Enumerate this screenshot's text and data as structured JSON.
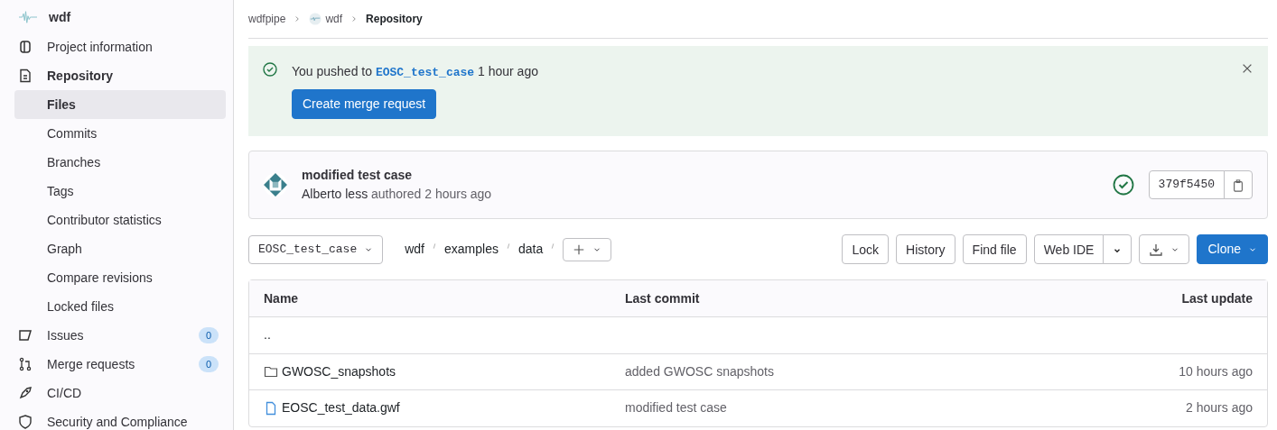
{
  "sidebar": {
    "project": {
      "name": "wdf"
    },
    "items": [
      {
        "label": "Project information",
        "kind": "info",
        "selected": false
      },
      {
        "label": "Repository",
        "kind": "repo",
        "selected": false,
        "children": [
          {
            "label": "Files",
            "selected": true
          },
          {
            "label": "Commits",
            "selected": false
          },
          {
            "label": "Branches",
            "selected": false
          },
          {
            "label": "Tags",
            "selected": false
          },
          {
            "label": "Contributor statistics",
            "selected": false
          },
          {
            "label": "Graph",
            "selected": false
          },
          {
            "label": "Compare revisions",
            "selected": false
          },
          {
            "label": "Locked files",
            "selected": false
          }
        ]
      },
      {
        "label": "Issues",
        "kind": "issues",
        "selected": false,
        "badge": "0"
      },
      {
        "label": "Merge requests",
        "kind": "merge",
        "selected": false,
        "badge": "0"
      },
      {
        "label": "CI/CD",
        "kind": "rocket",
        "selected": false
      },
      {
        "label": "Security and Compliance",
        "kind": "shield",
        "selected": false
      }
    ]
  },
  "breadcrumbs": [
    {
      "label": "wdfpipe",
      "avatar": false
    },
    {
      "label": "wdf",
      "avatar": true
    },
    {
      "label": "Repository",
      "avatar": false
    }
  ],
  "alert": {
    "text_before": "You pushed to",
    "branch": "EOSC_test_case",
    "text_after": "1 hour ago",
    "button": "Create merge request"
  },
  "commit": {
    "title": "modified test case",
    "author": "Alberto less",
    "meta": "authored 2 hours ago",
    "sha": "379f5450"
  },
  "toolbar": {
    "branch": "EOSC_test_case",
    "path": [
      "wdf",
      "examples",
      "data"
    ],
    "buttons": [
      {
        "label": "Lock",
        "kind": "plain"
      },
      {
        "label": "History",
        "kind": "plain"
      },
      {
        "label": "Find file",
        "kind": "plain"
      },
      {
        "label": "Web IDE",
        "kind": "split"
      },
      {
        "kind": "download"
      },
      {
        "label": "Clone",
        "kind": "primary"
      }
    ]
  },
  "table": {
    "columns": [
      "Name",
      "Last commit",
      "Last update"
    ],
    "rows": [
      {
        "kind": "parent",
        "name": ".."
      },
      {
        "kind": "folder",
        "name": "GWOSC_snapshots",
        "commit": "added GWOSC snapshots",
        "updated": "10 hours ago"
      },
      {
        "kind": "file",
        "name": "EOSC_test_data.gwf",
        "commit": "modified test case",
        "updated": "2 hours ago"
      }
    ]
  }
}
